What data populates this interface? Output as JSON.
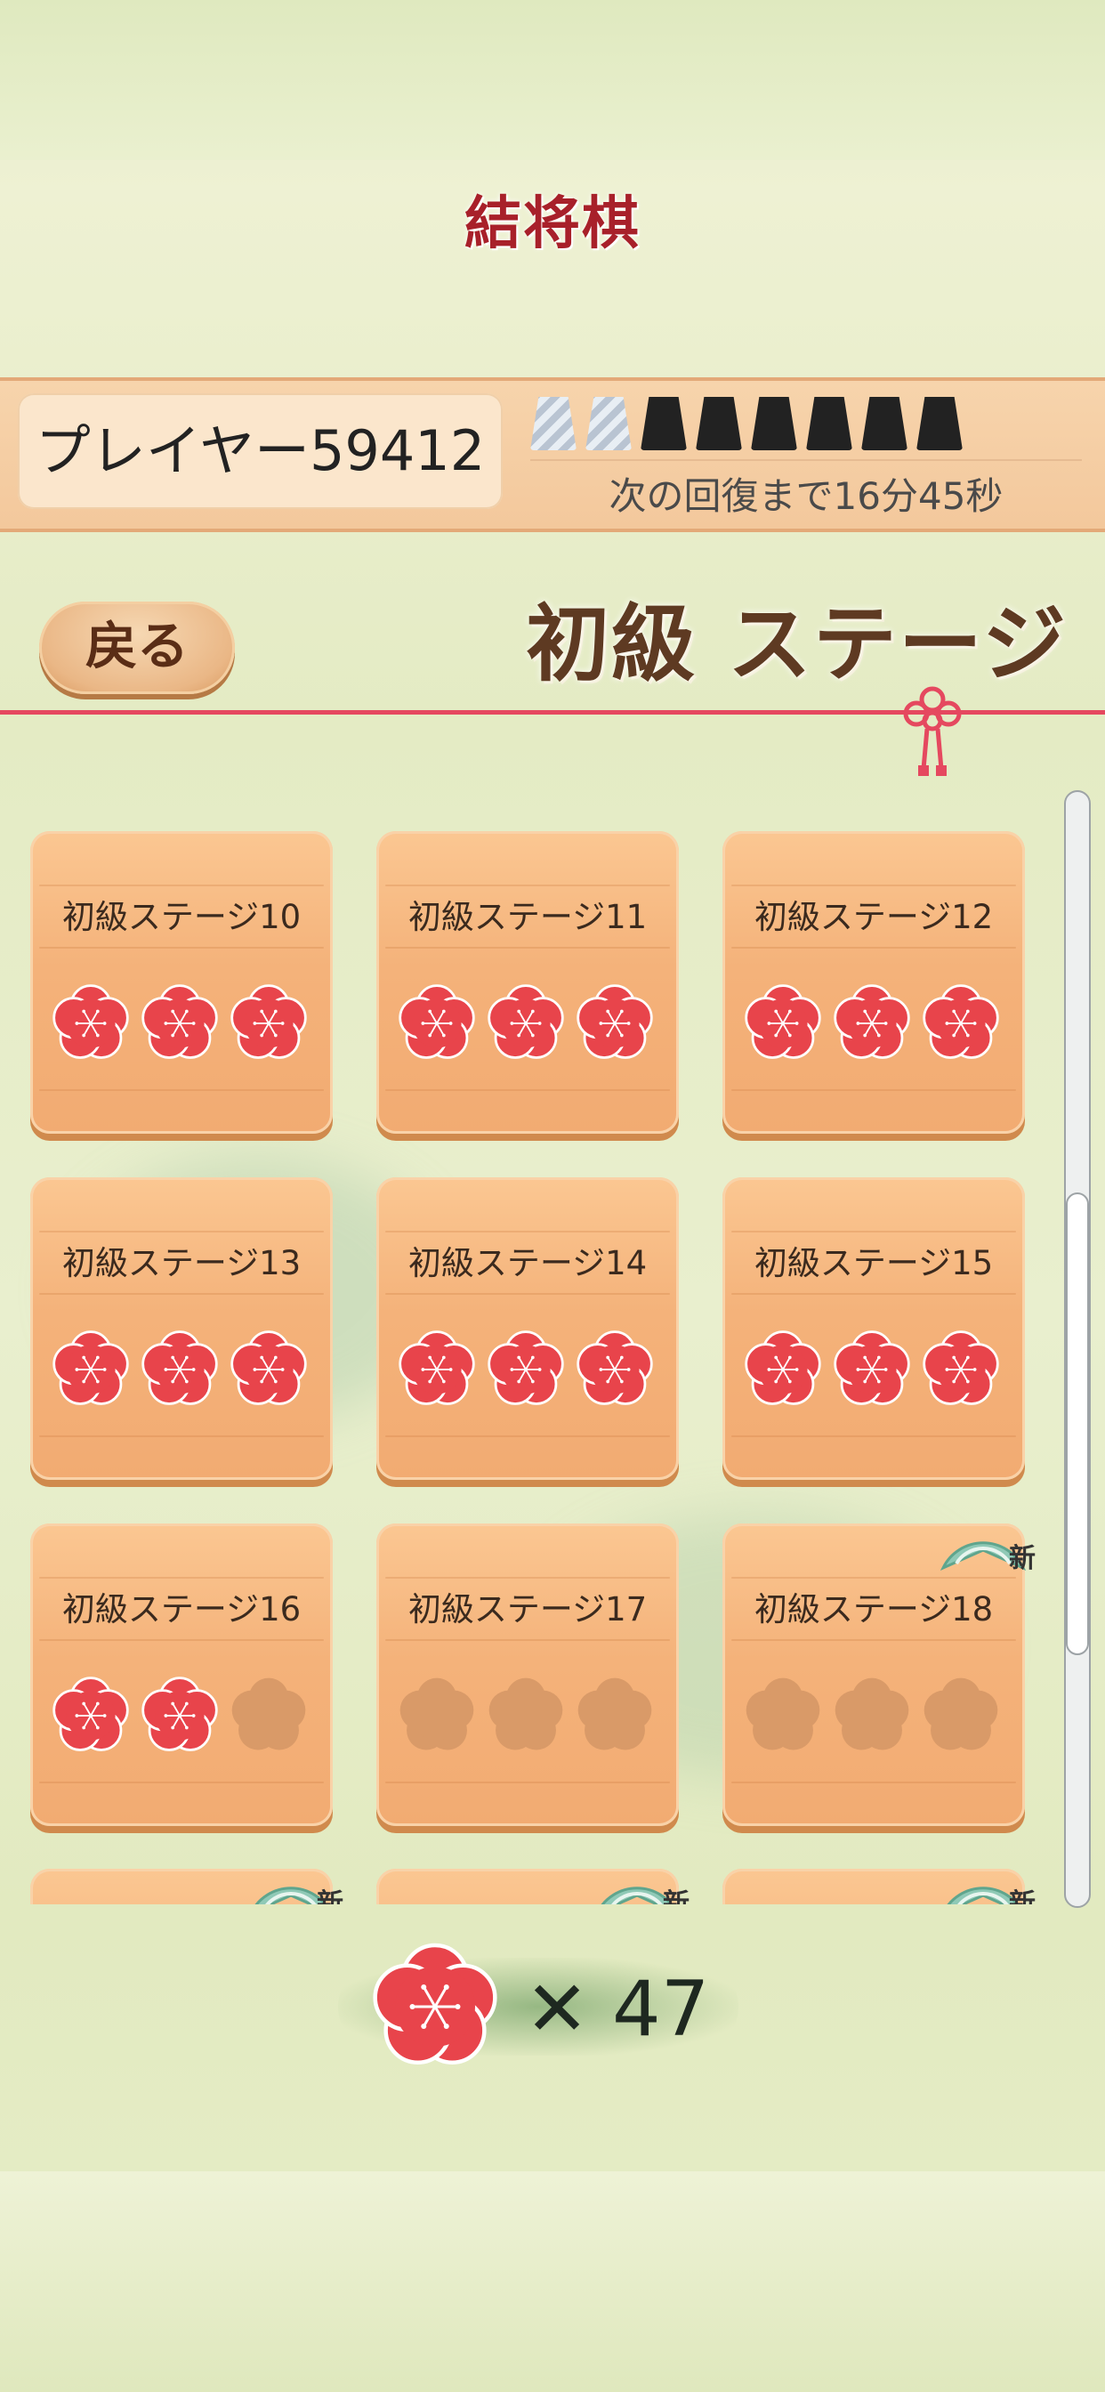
{
  "app_title": "結将棋",
  "player": {
    "name": "プレイヤー59412"
  },
  "stamina": {
    "full": 6,
    "empty": 2,
    "total": 8
  },
  "recovery_text": "次の回復まで16分45秒",
  "nav": {
    "back_label": "戻る",
    "stage_title": "初級 ステージ"
  },
  "stages": [
    {
      "label": "初級ステージ10",
      "stars": 3,
      "new": false
    },
    {
      "label": "初級ステージ11",
      "stars": 3,
      "new": false
    },
    {
      "label": "初級ステージ12",
      "stars": 3,
      "new": false
    },
    {
      "label": "初級ステージ13",
      "stars": 3,
      "new": false
    },
    {
      "label": "初級ステージ14",
      "stars": 3,
      "new": false
    },
    {
      "label": "初級ステージ15",
      "stars": 3,
      "new": false
    },
    {
      "label": "初級ステージ16",
      "stars": 2,
      "new": false
    },
    {
      "label": "初級ステージ17",
      "stars": 0,
      "new": false
    },
    {
      "label": "初級ステージ18",
      "stars": 0,
      "new": true
    },
    {
      "label": "",
      "stars": 0,
      "new": true
    },
    {
      "label": "",
      "stars": 0,
      "new": true
    },
    {
      "label": "",
      "stars": 0,
      "new": true
    }
  ],
  "new_badge_text": "新",
  "total": {
    "symbol": "✕",
    "count": "47"
  },
  "colors": {
    "flower_red": "#e8444b",
    "tile": "#f4b27a",
    "accent_line": "#e5485f"
  }
}
